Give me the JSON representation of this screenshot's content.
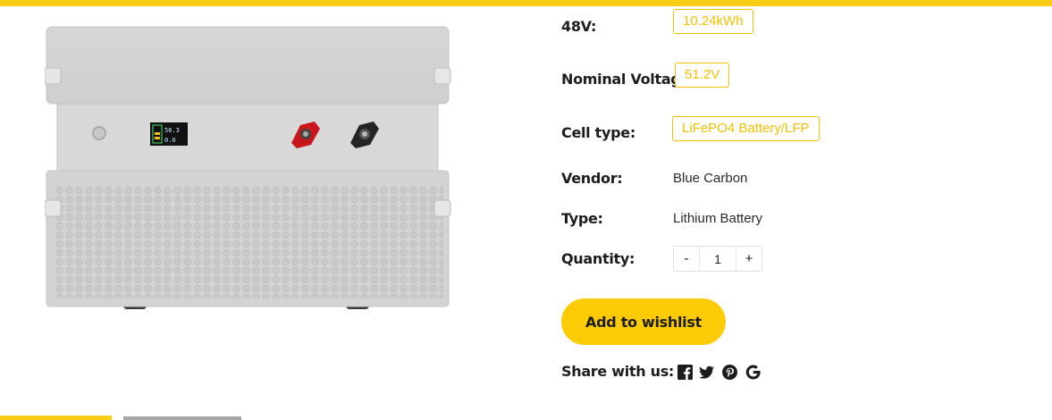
{
  "options": [
    {
      "label": "48V:",
      "value": "10.24kWh"
    },
    {
      "label": "Nominal Voltage:",
      "value": "51.2V"
    },
    {
      "label": "Cell type:",
      "value": "LiFePO4 Battery/LFP"
    }
  ],
  "meta": {
    "vendor_label": "Vendor:",
    "vendor_value": "Blue Carbon",
    "type_label": "Type:",
    "type_value": "Lithium Battery"
  },
  "quantity": {
    "label": "Quantity:",
    "minus": "-",
    "value": "1",
    "plus": "+"
  },
  "wishlist_label": "Add to wishlist",
  "share": {
    "label": "Share with us:",
    "icons": [
      "facebook-icon",
      "twitter-icon",
      "pinterest-icon",
      "google-icon"
    ]
  },
  "display": {
    "line1": "56.3",
    "line2": "0.0"
  },
  "colors": {
    "accent": "#f9cd15",
    "chip": "#f2c200"
  }
}
